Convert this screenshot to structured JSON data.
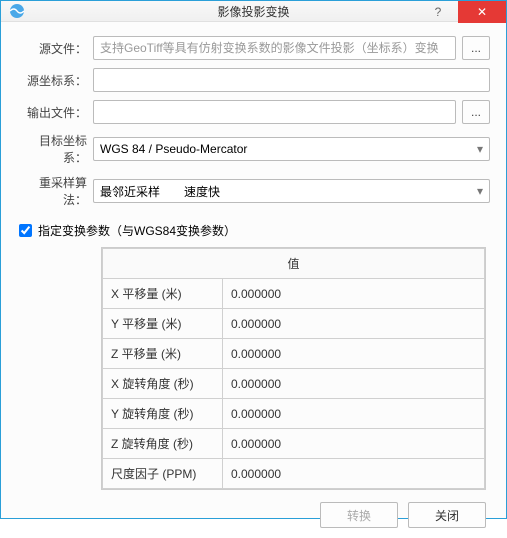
{
  "window": {
    "title": "影像投影变换",
    "help_glyph": "?",
    "close_glyph": "✕"
  },
  "form": {
    "browse_glyph": "...",
    "source_file": {
      "label": "源文件：",
      "placeholder": "支持GeoTiff等具有仿射变换系数的影像文件投影（坐标系）变换",
      "value": ""
    },
    "source_crs": {
      "label": "源坐标系：",
      "value": ""
    },
    "output_file": {
      "label": "输出文件：",
      "value": ""
    },
    "target_crs": {
      "label": "目标坐标系：",
      "value": "WGS 84 / Pseudo-Mercator"
    },
    "resample": {
      "label": "重采样算法：",
      "value": "最邻近采样　　速度快"
    },
    "specify_params": {
      "label": "指定变换参数（与WGS84变换参数）",
      "checked": true
    }
  },
  "table": {
    "header": "值",
    "rows": [
      {
        "name": "X 平移量 (米)",
        "value": "0.000000"
      },
      {
        "name": "Y 平移量 (米)",
        "value": "0.000000"
      },
      {
        "name": "Z 平移量 (米)",
        "value": "0.000000"
      },
      {
        "name": "X 旋转角度 (秒)",
        "value": "0.000000"
      },
      {
        "name": "Y 旋转角度 (秒)",
        "value": "0.000000"
      },
      {
        "name": "Z 旋转角度 (秒)",
        "value": "0.000000"
      },
      {
        "name": "尺度因子 (PPM)",
        "value": "0.000000"
      }
    ]
  },
  "buttons": {
    "transform": "转换",
    "close": "关闭"
  }
}
